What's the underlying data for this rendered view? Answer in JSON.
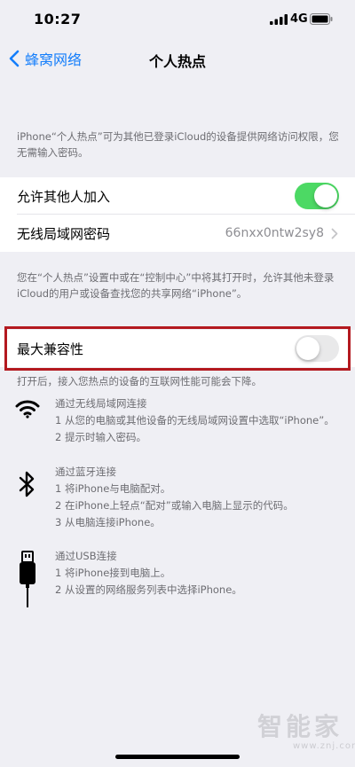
{
  "status": {
    "time": "10:27",
    "network": "4G"
  },
  "nav": {
    "back_label": "蜂窝网络",
    "title": "个人热点"
  },
  "intro_text": "iPhone“个人热点”可为其他已登录iCloud的设备提供网络访问权限，您无需输入密码。",
  "settings": {
    "allow_others": {
      "label": "允许其他人加入",
      "state": "on"
    },
    "wifi_password": {
      "label": "无线局域网密码",
      "value": "66nxx0ntw2sy8"
    }
  },
  "discover_text": "您在“个人热点”设置中或在“控制中心”中将其打开时，允许其他未登录iCloud的用户或设备查找您的共享网络“iPhone”。",
  "max_compat": {
    "label": "最大兼容性",
    "state": "off",
    "footnote": "打开后，接入您热点的设备的互联网性能可能会下降。"
  },
  "connect_methods": [
    {
      "icon": "wifi-icon",
      "title": "通过无线局域网连接",
      "steps": [
        "1 从您的电脑或其他设备的无线局域网设置中选取“iPhone”。",
        "2 提示时输入密码。"
      ]
    },
    {
      "icon": "bluetooth-icon",
      "title": "通过蓝牙连接",
      "steps": [
        "1 将iPhone与电脑配对。",
        "2 在iPhone上轻点“配对”或输入电脑上显示的代码。",
        "3 从电脑连接iPhone。"
      ]
    },
    {
      "icon": "usb-cable-icon",
      "title": "通过USB连接",
      "steps": [
        "1 将iPhone接到电脑上。",
        "2 从设置的网络服务列表中选择iPhone。"
      ]
    }
  ],
  "watermark": {
    "text": "智能家",
    "url": "www.znj.com"
  },
  "colors": {
    "accent": "#147efb",
    "toggle_on": "#4cd964",
    "highlight": "#b3191f"
  }
}
